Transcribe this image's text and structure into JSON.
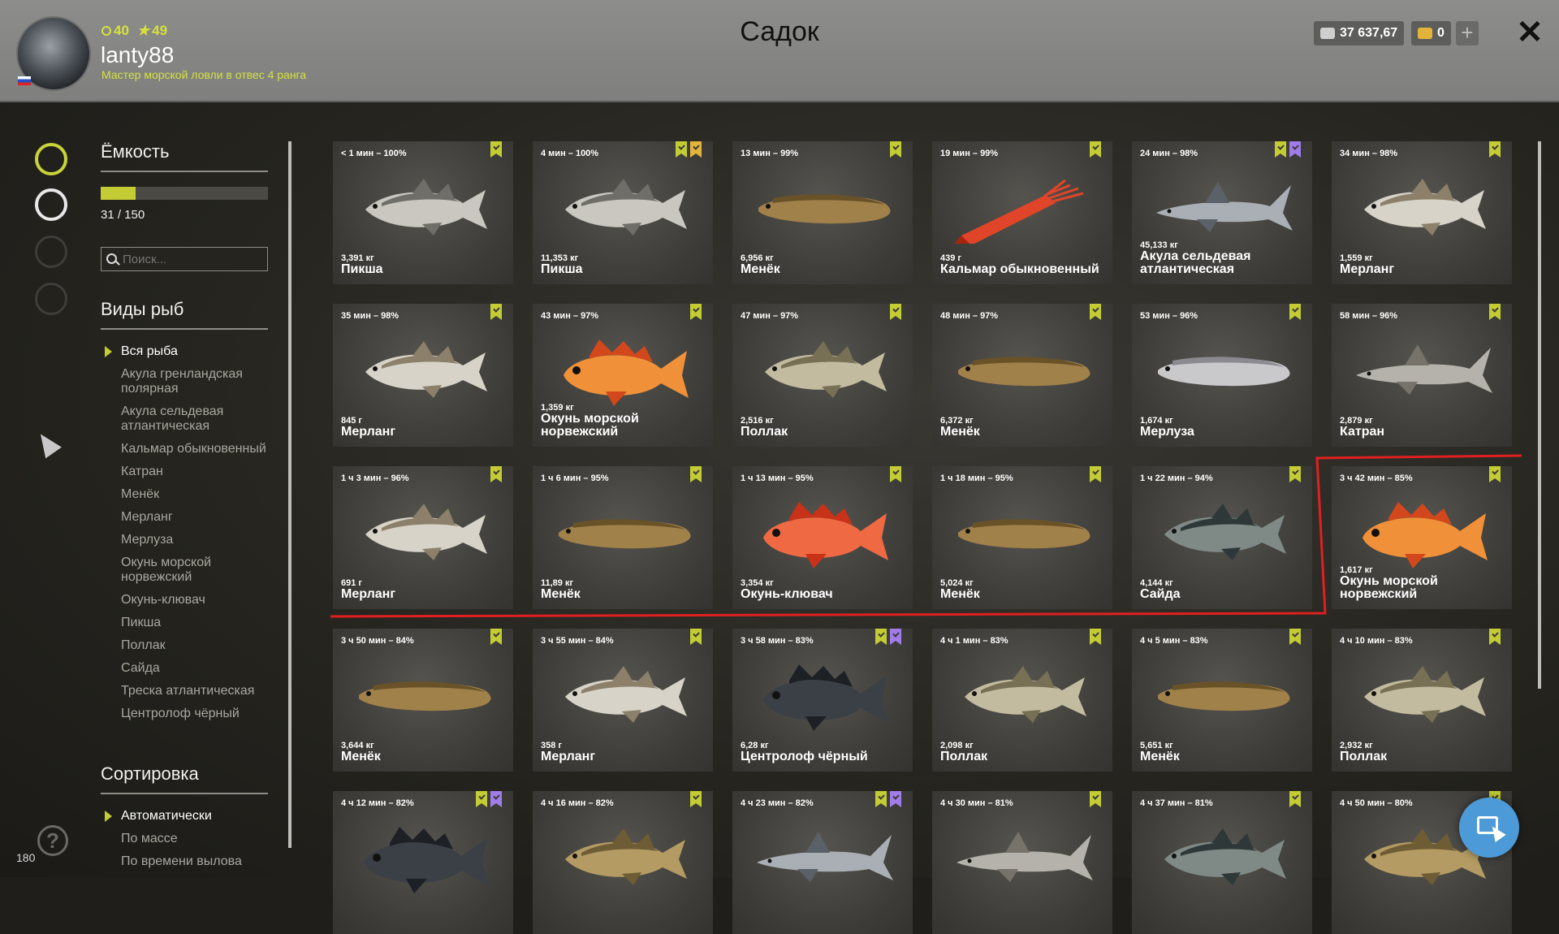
{
  "header": {
    "stat_xp": "40",
    "stat_stars": "49",
    "username": "lanty88",
    "rank": "Мастер морской ловли в отвес 4 ранга",
    "title": "Садок",
    "silver": "37 637,67",
    "gold": "0",
    "plus": "+",
    "close": "✕"
  },
  "sidebar": {
    "capacity_title": "Ёмкость",
    "capacity_fraction": 0.2067,
    "capacity_text": "31 / 150",
    "search_placeholder": "Поиск...",
    "species_title": "Виды рыб",
    "species": [
      "Вся рыба",
      "Акула гренландская полярная",
      "Акула сельдевая атлантическая",
      "Кальмар обыкновенный",
      "Катран",
      "Менёк",
      "Мерланг",
      "Мерлуза",
      "Окунь морской норвежский",
      "Окунь-клювач",
      "Пикша",
      "Поллак",
      "Сайда",
      "Треска атлантическая",
      "Центролоф чёрный"
    ],
    "sort_title": "Сортировка",
    "sort": [
      "Автоматически",
      "По массе",
      "По времени вылова"
    ],
    "help": "?",
    "version": "180"
  },
  "colors": {
    "accent_lime": "#c3cc34",
    "marker_purple": "#a07ce8",
    "highlight_red": "#e02020"
  },
  "fish": [
    {
      "time": "< 1 мин – 100%",
      "weight": "3,391 кг",
      "name": "Пикша",
      "kind": "haddock",
      "marks": [
        "lime"
      ]
    },
    {
      "time": "4 мин – 100%",
      "weight": "11,353 кг",
      "name": "Пикша",
      "kind": "haddock",
      "marks": [
        "lime",
        "gold"
      ]
    },
    {
      "time": "13 мин – 99%",
      "weight": "6,956 кг",
      "name": "Менёк",
      "kind": "tusk",
      "marks": [
        "lime"
      ]
    },
    {
      "time": "19 мин – 99%",
      "weight": "439 г",
      "name": "Кальмар обыкновенный",
      "kind": "squid",
      "marks": [
        "lime"
      ]
    },
    {
      "time": "24 мин – 98%",
      "weight": "45,133 кг",
      "name": "Акула сельдевая атлантическая",
      "kind": "shark",
      "marks": [
        "lime",
        "purple"
      ]
    },
    {
      "time": "34 мин – 98%",
      "weight": "1,559 кг",
      "name": "Мерланг",
      "kind": "whiting",
      "marks": [
        "lime"
      ]
    },
    {
      "time": "35 мин – 98%",
      "weight": "845 г",
      "name": "Мерланг",
      "kind": "whiting",
      "marks": [
        "lime"
      ]
    },
    {
      "time": "43 мин – 97%",
      "weight": "1,359 кг",
      "name": "Окунь морской норвежский",
      "kind": "redfish",
      "marks": [
        "lime"
      ]
    },
    {
      "time": "47 мин – 97%",
      "weight": "2,516 кг",
      "name": "Поллак",
      "kind": "pollack",
      "marks": [
        "lime"
      ]
    },
    {
      "time": "48 мин – 97%",
      "weight": "6,372 кг",
      "name": "Менёк",
      "kind": "tusk",
      "marks": [
        "lime"
      ]
    },
    {
      "time": "53 мин – 96%",
      "weight": "1,674 кг",
      "name": "Мерлуза",
      "kind": "hake",
      "marks": [
        "lime"
      ]
    },
    {
      "time": "58 мин – 96%",
      "weight": "2,879 кг",
      "name": "Катран",
      "kind": "dogfish",
      "marks": [
        "lime"
      ]
    },
    {
      "time": "1 ч 3 мин – 96%",
      "weight": "691 г",
      "name": "Мерланг",
      "kind": "whiting",
      "marks": [
        "lime"
      ]
    },
    {
      "time": "1 ч 6 мин – 95%",
      "weight": "11,89 кг",
      "name": "Менёк",
      "kind": "tusk",
      "marks": [
        "lime"
      ]
    },
    {
      "time": "1 ч 13 мин – 95%",
      "weight": "3,354 кг",
      "name": "Окунь-клювач",
      "kind": "redfish_red",
      "marks": [
        "lime"
      ]
    },
    {
      "time": "1 ч 18 мин – 95%",
      "weight": "5,024 кг",
      "name": "Менёк",
      "kind": "tusk",
      "marks": [
        "lime"
      ]
    },
    {
      "time": "1 ч 22 мин – 94%",
      "weight": "4,144 кг",
      "name": "Сайда",
      "kind": "saithe",
      "marks": [
        "lime"
      ]
    },
    {
      "time": "3 ч 42 мин – 85%",
      "weight": "1,617 кг",
      "name": "Окунь морской норвежский",
      "kind": "redfish",
      "marks": [
        "lime"
      ]
    },
    {
      "time": "3 ч 50 мин – 84%",
      "weight": "3,644 кг",
      "name": "Менёк",
      "kind": "tusk",
      "marks": [
        "lime"
      ]
    },
    {
      "time": "3 ч 55 мин – 84%",
      "weight": "358 г",
      "name": "Мерланг",
      "kind": "whiting",
      "marks": [
        "lime"
      ]
    },
    {
      "time": "3 ч 58 мин – 83%",
      "weight": "6,28 кг",
      "name": "Центролоф чёрный",
      "kind": "blackfish",
      "marks": [
        "lime",
        "purple"
      ]
    },
    {
      "time": "4 ч 1 мин – 83%",
      "weight": "2,098 кг",
      "name": "Поллак",
      "kind": "pollack",
      "marks": [
        "lime"
      ]
    },
    {
      "time": "4 ч 5 мин – 83%",
      "weight": "5,651 кг",
      "name": "Менёк",
      "kind": "tusk",
      "marks": [
        "lime"
      ]
    },
    {
      "time": "4 ч 10 мин – 83%",
      "weight": "2,932 кг",
      "name": "Поллак",
      "kind": "pollack",
      "marks": [
        "lime"
      ]
    },
    {
      "time": "4 ч 12 мин – 82%",
      "weight": "",
      "name": "",
      "kind": "blackfish",
      "marks": [
        "lime",
        "purple"
      ]
    },
    {
      "time": "4 ч 16 мин – 82%",
      "weight": "",
      "name": "",
      "kind": "cod",
      "marks": [
        "lime"
      ]
    },
    {
      "time": "4 ч 23 мин – 82%",
      "weight": "",
      "name": "",
      "kind": "shark",
      "marks": [
        "lime",
        "purple"
      ]
    },
    {
      "time": "4 ч 30 мин – 81%",
      "weight": "",
      "name": "",
      "kind": "dogfish",
      "marks": [
        "lime"
      ]
    },
    {
      "time": "4 ч 37 мин – 81%",
      "weight": "",
      "name": "",
      "kind": "saithe",
      "marks": [
        "lime"
      ]
    },
    {
      "time": "4 ч 50 мин – 80%",
      "weight": "",
      "name": "",
      "kind": "cod",
      "marks": [
        "lime"
      ]
    }
  ]
}
